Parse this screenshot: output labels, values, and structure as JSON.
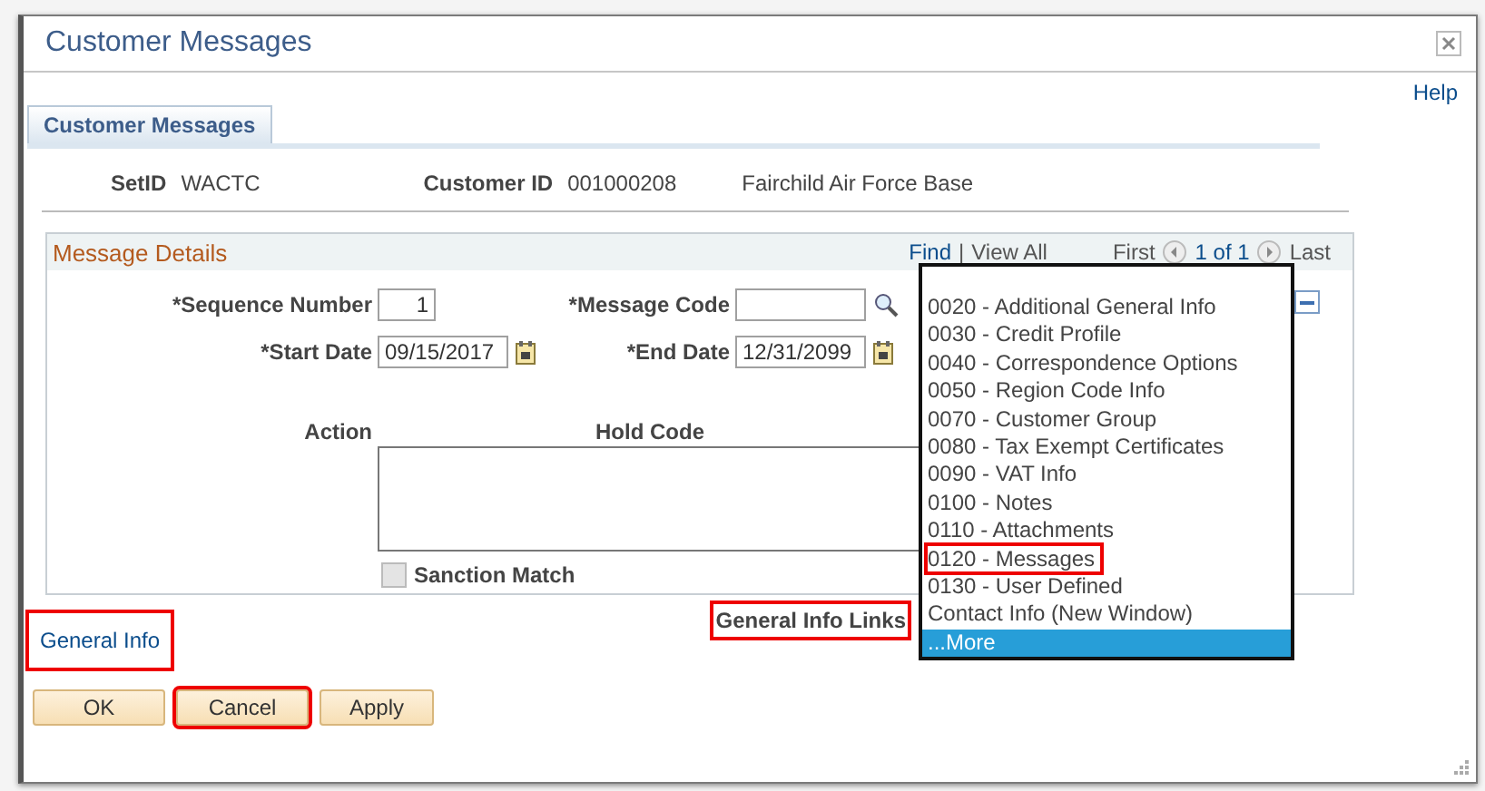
{
  "window": {
    "title": "Customer Messages",
    "help": "Help"
  },
  "tabs": [
    {
      "label": "Customer Messages",
      "selected": true
    }
  ],
  "header": {
    "setid_label": "SetID",
    "setid": "WACTC",
    "customer_id_label": "Customer ID",
    "customer_id": "001000208",
    "customer_name": "Fairchild Air Force Base"
  },
  "panel": {
    "title": "Message Details",
    "nav": {
      "find": "Find",
      "separator": "|",
      "view_all": "View All",
      "first": "First",
      "count": "1 of 1",
      "last": "Last"
    },
    "sequence_label": "*Sequence Number",
    "sequence": "1",
    "message_code_label": "*Message Code",
    "start_date_label": "*Start Date",
    "start_date": "09/15/2017",
    "end_date_label": "*End Date",
    "end_date": "12/31/2099",
    "action_label": "Action",
    "hold_code_label": "Hold Code",
    "sanction_label": "Sanction Match",
    "sanction_checked": false,
    "sanction_disabled": true
  },
  "links": [
    {
      "label": "General Info",
      "highlighted": true
    }
  ],
  "links_menu": {
    "label": "General Info Links",
    "highlighted": true,
    "items": [
      {
        "label": "0020 - Additional General Info",
        "selected": false,
        "highlighted": false
      },
      {
        "label": "0030 - Credit Profile",
        "selected": false,
        "highlighted": false
      },
      {
        "label": "0040 - Correspondence Options",
        "selected": false,
        "highlighted": false
      },
      {
        "label": "0050 - Region Code Info",
        "selected": false,
        "highlighted": false
      },
      {
        "label": "0070 - Customer Group",
        "selected": false,
        "highlighted": false
      },
      {
        "label": "0080 - Tax Exempt Certificates",
        "selected": false,
        "highlighted": false
      },
      {
        "label": "0090 - VAT Info",
        "selected": false,
        "highlighted": false
      },
      {
        "label": "0100 - Notes",
        "selected": false,
        "highlighted": false
      },
      {
        "label": "0110 - Attachments",
        "selected": false,
        "highlighted": false
      },
      {
        "label": "0120 - Messages",
        "selected": false,
        "highlighted": true
      },
      {
        "label": "0130 - User Defined",
        "selected": false,
        "highlighted": false
      },
      {
        "label": "Contact Info (New Window)",
        "selected": false,
        "highlighted": false
      },
      {
        "label": "...More",
        "selected": true,
        "highlighted": false
      }
    ]
  },
  "buttons": [
    {
      "label": "OK",
      "highlighted": false
    },
    {
      "label": "Cancel",
      "highlighted": true
    },
    {
      "label": "Apply",
      "highlighted": false
    }
  ]
}
